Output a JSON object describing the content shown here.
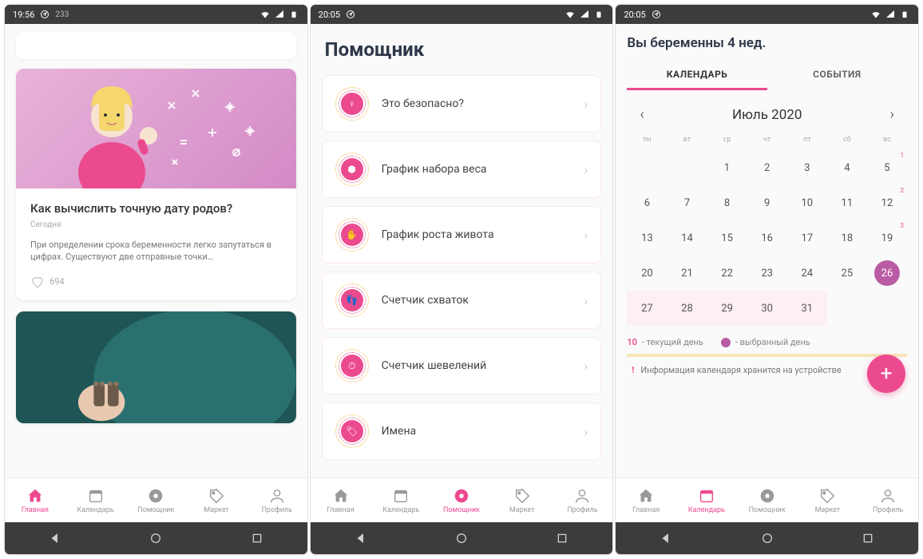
{
  "screens": [
    {
      "status": {
        "time": "19:56",
        "extra": "233"
      },
      "article": {
        "title": "Как вычислить точную дату родов?",
        "date": "Сегодня",
        "text": "При определении срока беременности легко запутаться в цифрах. Существуют две отправные точки…",
        "likes": "694"
      },
      "nav_active": 0
    },
    {
      "status": {
        "time": "20:05"
      },
      "title": "Помощник",
      "items": [
        {
          "label": "Это безопасно?"
        },
        {
          "label": "График набора веса"
        },
        {
          "label": "График роста живота"
        },
        {
          "label": "Счетчик схваток"
        },
        {
          "label": "Счетчик шевелений"
        },
        {
          "label": "Имена"
        }
      ],
      "nav_active": 2
    },
    {
      "status": {
        "time": "20:05"
      },
      "title": "Вы беременны 4 нед.",
      "tabs": [
        "КАЛЕНДАРЬ",
        "СОБЫТИЯ"
      ],
      "month": "Июль 2020",
      "weekdays": [
        "пн",
        "вт",
        "ср",
        "чт",
        "пт",
        "сб",
        "вс"
      ],
      "days": [
        [
          "",
          "",
          "1",
          "2",
          "3",
          "4",
          "5"
        ],
        [
          "6",
          "7",
          "8",
          "9",
          "10",
          "11",
          "12"
        ],
        [
          "13",
          "14",
          "15",
          "16",
          "17",
          "18",
          "19"
        ],
        [
          "20",
          "21",
          "22",
          "23",
          "24",
          "25",
          "26"
        ],
        [
          "27",
          "28",
          "29",
          "30",
          "31",
          "",
          ""
        ]
      ],
      "badges": {
        "5": "1",
        "12": "2",
        "19": "3"
      },
      "selected": "26",
      "hl_row": 4,
      "legend": {
        "current_num": "10",
        "current": "- текущий день",
        "selected": "- выбранный день"
      },
      "info": "Информация календаря хранится на устройстве",
      "nav_active": 1
    }
  ],
  "nav": [
    {
      "label": "Главная",
      "icon": "home"
    },
    {
      "label": "Календарь",
      "icon": "calendar"
    },
    {
      "label": "Помощник",
      "icon": "disc"
    },
    {
      "label": "Маркет",
      "icon": "tag"
    },
    {
      "label": "Профиль",
      "icon": "person"
    }
  ]
}
